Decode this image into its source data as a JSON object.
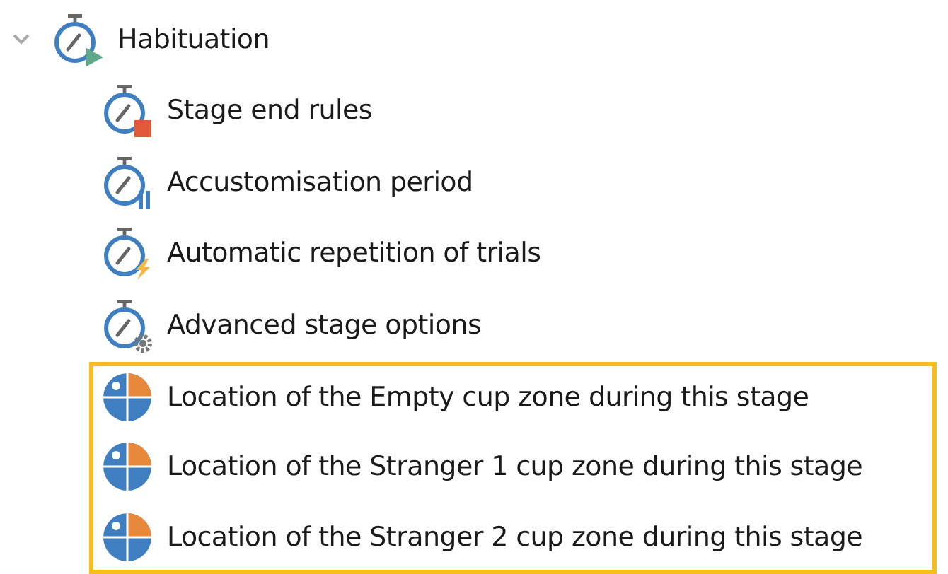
{
  "tree": {
    "label": "Habituation",
    "kind": "start",
    "expanded": true,
    "children": [
      {
        "label": "Stage end rules",
        "kind": "end",
        "highlighted": false
      },
      {
        "label": "Accustomisation period",
        "kind": "pause",
        "highlighted": false
      },
      {
        "label": "Automatic repetition of trials",
        "kind": "repeat",
        "highlighted": false
      },
      {
        "label": "Advanced stage options",
        "kind": "options",
        "highlighted": false
      },
      {
        "label": "Location of the Empty cup zone during this stage",
        "kind": "zone",
        "highlighted": true
      },
      {
        "label": "Location of the Stranger 1 cup zone during this stage",
        "kind": "zone",
        "highlighted": true
      },
      {
        "label": "Location of the Stranger 2 cup zone during this stage",
        "kind": "zone",
        "highlighted": true
      }
    ]
  }
}
